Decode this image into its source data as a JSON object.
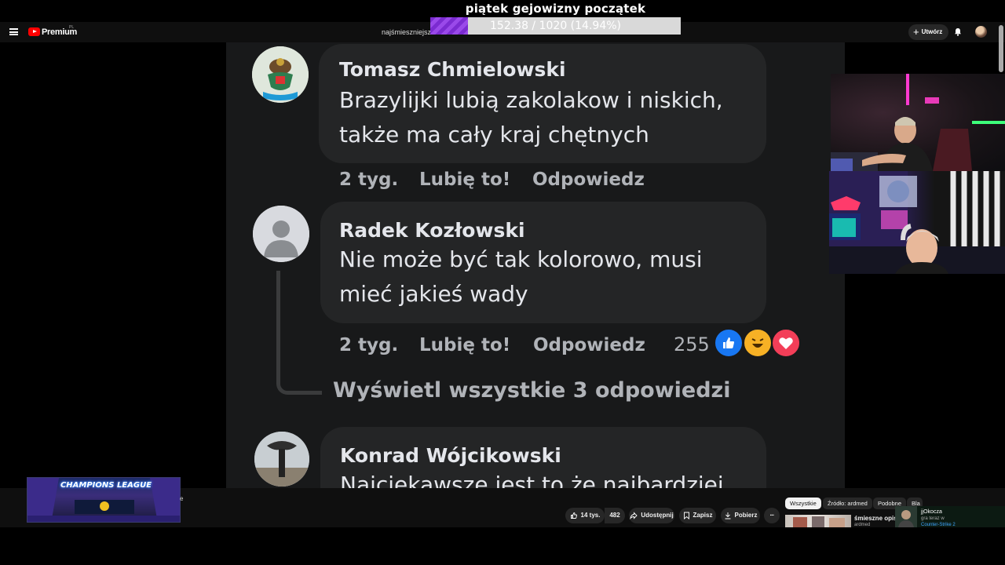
{
  "overlay": {
    "title": "piątek gejowizny początek",
    "progress_text": "152.38 / 1020 (14.94%)",
    "progress_fraction": 0.1494,
    "progress_color": "#8a3ce0"
  },
  "topbar": {
    "menu_icon": "hamburger-menu-icon",
    "logo_icon": "youtube-logo-icon",
    "brand": "Premium",
    "region": "PL",
    "search_fragment": "najśmieszniejsze",
    "create_label": "Utwórz",
    "create_icon": "plus-icon",
    "notifications_icon": "bell-icon",
    "avatar_icon": "user-avatar"
  },
  "comments": [
    {
      "name": "Tomasz Chmielowski",
      "lines": [
        "Brazylijki lubią zakolakow i niskich,",
        "także ma cały kraj chętnych"
      ],
      "time": "2 tyg.",
      "like_label": "Lubię to!",
      "reply_label": "Odpowiedz"
    },
    {
      "name": "Radek Kozłowski",
      "lines": [
        "Nie może być tak kolorowo, musi",
        "mieć jakieś wady"
      ],
      "time": "2 tyg.",
      "like_label": "Lubię to!",
      "reply_label": "Odpowiedz",
      "reaction_count": "255",
      "reactions": [
        "like-reaction-icon",
        "haha-reaction-icon",
        "love-reaction-icon"
      ],
      "view_replies": "Wyświetl wszystkie 3 odpowiedzi"
    },
    {
      "name": "Konrad Wójcikowski",
      "lines": [
        "Najciekawsze jest to że najbardziej"
      ]
    }
  ],
  "colors": {
    "fb_background": "#18191a",
    "fb_bubble": "#242526",
    "fb_text": "#e4e6eb",
    "fb_meta": "#b0b3b8",
    "like_blue": "#1877f2",
    "love_red": "#f33e58"
  },
  "bottom": {
    "thumbnail_title": "CHAMPIONS LEAGUE",
    "thumbnail_fragment": "e",
    "actions": {
      "like_count": "14 tys.",
      "dislike_count": "482",
      "share": "Udostępnij",
      "save": "Zapisz",
      "download": "Pobierz",
      "more": "···"
    },
    "chips": [
      "Wszystkie",
      "Źródło: ardmed",
      "Podobne",
      "Bla"
    ],
    "rec_title": "śmieszne opisy",
    "rec_sub": "ardmed",
    "live": {
      "name": "jjOkocza",
      "line1": "gra teraz w",
      "line2": "Counter-Strike 2"
    }
  }
}
